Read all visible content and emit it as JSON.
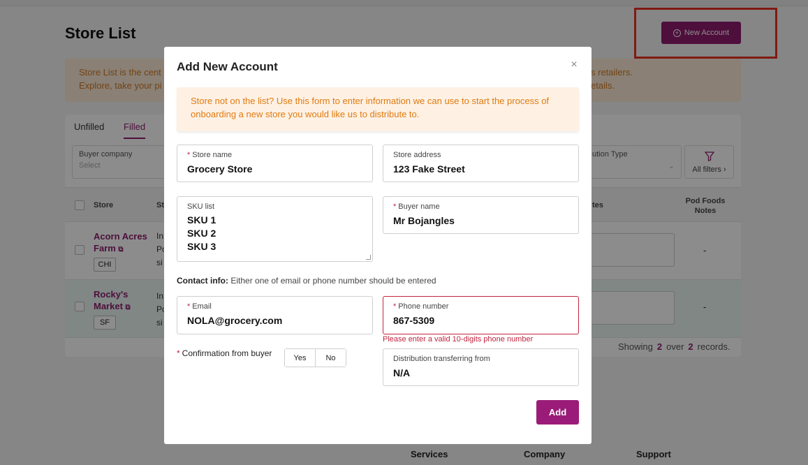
{
  "page": {
    "title": "Store List",
    "new_account_label": "New Account",
    "banner_left_1": "Store List is the cent",
    "banner_left_2": "Explore, take your pi",
    "banner_right_1": "s retailers.",
    "banner_right_2": "etails."
  },
  "tabs": [
    {
      "label": "Unfilled",
      "active": false
    },
    {
      "label": "Filled",
      "active": true
    }
  ],
  "filters": {
    "buyer_company_label": "Buyer company",
    "buyer_company_placeholder": "Select",
    "distribution_type_label": "ution Type",
    "all_filters_label": "All filters ›"
  },
  "table": {
    "headers": {
      "store": "Store",
      "status": "St",
      "notes": "tes",
      "pod_notes": "Pod Foods Notes"
    },
    "rows": [
      {
        "store": "Acorn Acres Farm",
        "region": "CHI",
        "lines": [
          "In",
          "Po",
          "si"
        ],
        "pod_note": "-"
      },
      {
        "store": "Rocky's Market",
        "region": "SF",
        "lines": [
          "In",
          "Po",
          "si"
        ],
        "pod_note": "-"
      }
    ],
    "showing_prefix": "Showing",
    "showing_count": "2",
    "showing_over": "over",
    "showing_total": "2",
    "showing_suffix": "records."
  },
  "footer": {
    "services": "Services",
    "company": "Company",
    "support": "Support"
  },
  "modal": {
    "title": "Add New Account",
    "alert": "Store not on the list? Use this form to enter information we can use to start the process of onboarding a new store you would like us to distribute to.",
    "store_name_label": "Store name",
    "store_name_value": "Grocery Store",
    "store_address_label": "Store address",
    "store_address_value": "123 Fake Street",
    "sku_label": "SKU list",
    "sku_value": "SKU 1\nSKU 2\nSKU 3",
    "buyer_name_label": "Buyer name",
    "buyer_name_value": "Mr Bojangles",
    "contact_info_label": "Contact info:",
    "contact_info_text": "Either one of email or phone number should be entered",
    "email_label": "Email",
    "email_value": "NOLA@grocery.com",
    "phone_label": "Phone number",
    "phone_value": "867-5309",
    "phone_error": "Please enter a valid 10-digits phone number",
    "confirmation_label": "Confirmation from buyer",
    "yes_label": "Yes",
    "no_label": "No",
    "distribution_label": "Distribution transferring from",
    "distribution_value": "N/A",
    "add_label": "Add",
    "required_mark": "*"
  }
}
